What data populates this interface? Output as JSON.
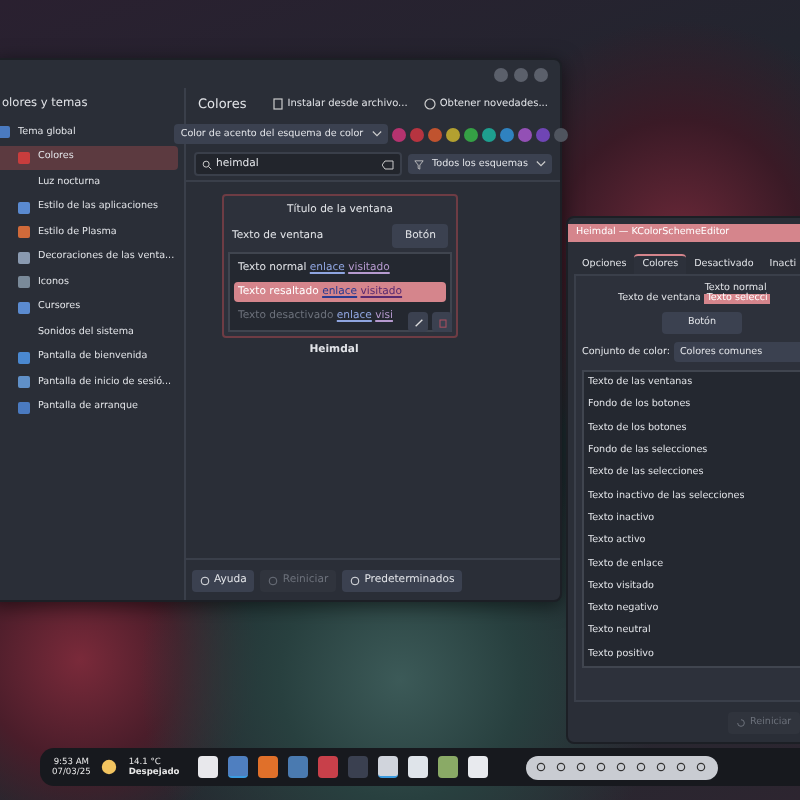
{
  "main_window": {
    "sidebar": {
      "title": "olores y temas",
      "items": [
        {
          "label": "Tema global",
          "selected": false,
          "icon": true,
          "children": [
            {
              "label": "Colores",
              "selected": true,
              "icon": true
            },
            {
              "label": "Luz nocturna",
              "selected": false,
              "icon": false
            },
            {
              "label": "Estilo de las aplicaciones",
              "selected": false,
              "icon": true
            },
            {
              "label": "Estilo de Plasma",
              "selected": false,
              "icon": true
            },
            {
              "label": "Decoraciones de las venta...",
              "selected": false,
              "icon": true
            },
            {
              "label": "Iconos",
              "selected": false,
              "icon": true
            },
            {
              "label": "Cursores",
              "selected": false,
              "icon": true
            },
            {
              "label": "Sonidos del sistema",
              "selected": false,
              "icon": false
            },
            {
              "label": "Pantalla de bienvenida",
              "selected": false,
              "icon": true
            },
            {
              "label": "Pantalla de inicio de sesió...",
              "selected": false,
              "icon": true
            },
            {
              "label": "Pantalla de arranque",
              "selected": false,
              "icon": true
            }
          ]
        }
      ]
    },
    "title": "Colores",
    "actions": [
      "Instalar desde archivo...",
      "Obtener novedades..."
    ],
    "accent_dropdown": "Color de acento del esquema de color",
    "swatches": [
      {
        "color": "#b5336f"
      },
      {
        "color": "#b73440"
      },
      {
        "color": "#c0532f"
      },
      {
        "color": "#b3a030"
      },
      {
        "color": "#35a045"
      },
      {
        "color": "#1e9f8f"
      },
      {
        "color": "#2f82c0"
      },
      {
        "color": "#9350b5"
      },
      {
        "color": "#6f45b5"
      },
      {
        "color": "#4f545e"
      }
    ],
    "search": {
      "value": "heimdal"
    },
    "filter": "Todos los esquemas",
    "schemes": [
      {
        "name": "Heimdal",
        "selected": true,
        "preview": {
          "title": "Título de la ventana",
          "window_text": "Texto de ventana",
          "button": "Botón",
          "rows": [
            {
              "kind": "normal",
              "text": "Texto normal",
              "link": "enlace",
              "visited": "visitado"
            },
            {
              "kind": "highlight",
              "text": "Texto resaltado",
              "link": "enlace",
              "visited": "visitado"
            },
            {
              "kind": "disabled",
              "text": "Texto desactivado",
              "link": "enlace",
              "visited": "visi"
            }
          ]
        }
      }
    ],
    "buttons": [
      {
        "label": "Ayuda",
        "disabled": false
      },
      {
        "label": "Reiniciar",
        "disabled": true
      },
      {
        "label": "Predeterminados",
        "disabled": false
      }
    ]
  },
  "editor_window": {
    "title": "Heimdal — KColorSchemeEditor",
    "tabs": [
      {
        "label": "Opciones",
        "selected": false
      },
      {
        "label": "Colores",
        "selected": true
      },
      {
        "label": "Desactivado",
        "selected": false
      },
      {
        "label": "Inacti",
        "selected": false
      }
    ],
    "window_text": "Texto de ventana",
    "sample_normal": "Texto normal",
    "sample_selected": "Texto selecci",
    "button": "Botón",
    "color_set_label": "Conjunto de color:",
    "color_set": "Colores comunes",
    "roles": [
      "Texto de las ventanas",
      "Fondo de los botones",
      "Texto de los botones",
      "Fondo de las selecciones",
      "Texto de las selecciones",
      "Texto inactivo de las selecciones",
      "Texto inactivo",
      "Texto activo",
      "Texto de enlace",
      "Texto visitado",
      "Texto negativo",
      "Texto neutral",
      "Texto positivo"
    ],
    "reset": {
      "label": "Reiniciar",
      "disabled": true
    }
  },
  "taskbar": {
    "time": "9:53 AM",
    "date": "07/03/25",
    "temperature": "14.1 °C",
    "weather": "Despejado",
    "apps": [
      {
        "active": false
      },
      {
        "active": true
      },
      {
        "active": false
      },
      {
        "active": false
      },
      {
        "active": false
      },
      {
        "active": false
      },
      {
        "active": true
      },
      {
        "active": false
      },
      {
        "active": false
      },
      {
        "active": false
      }
    ]
  }
}
